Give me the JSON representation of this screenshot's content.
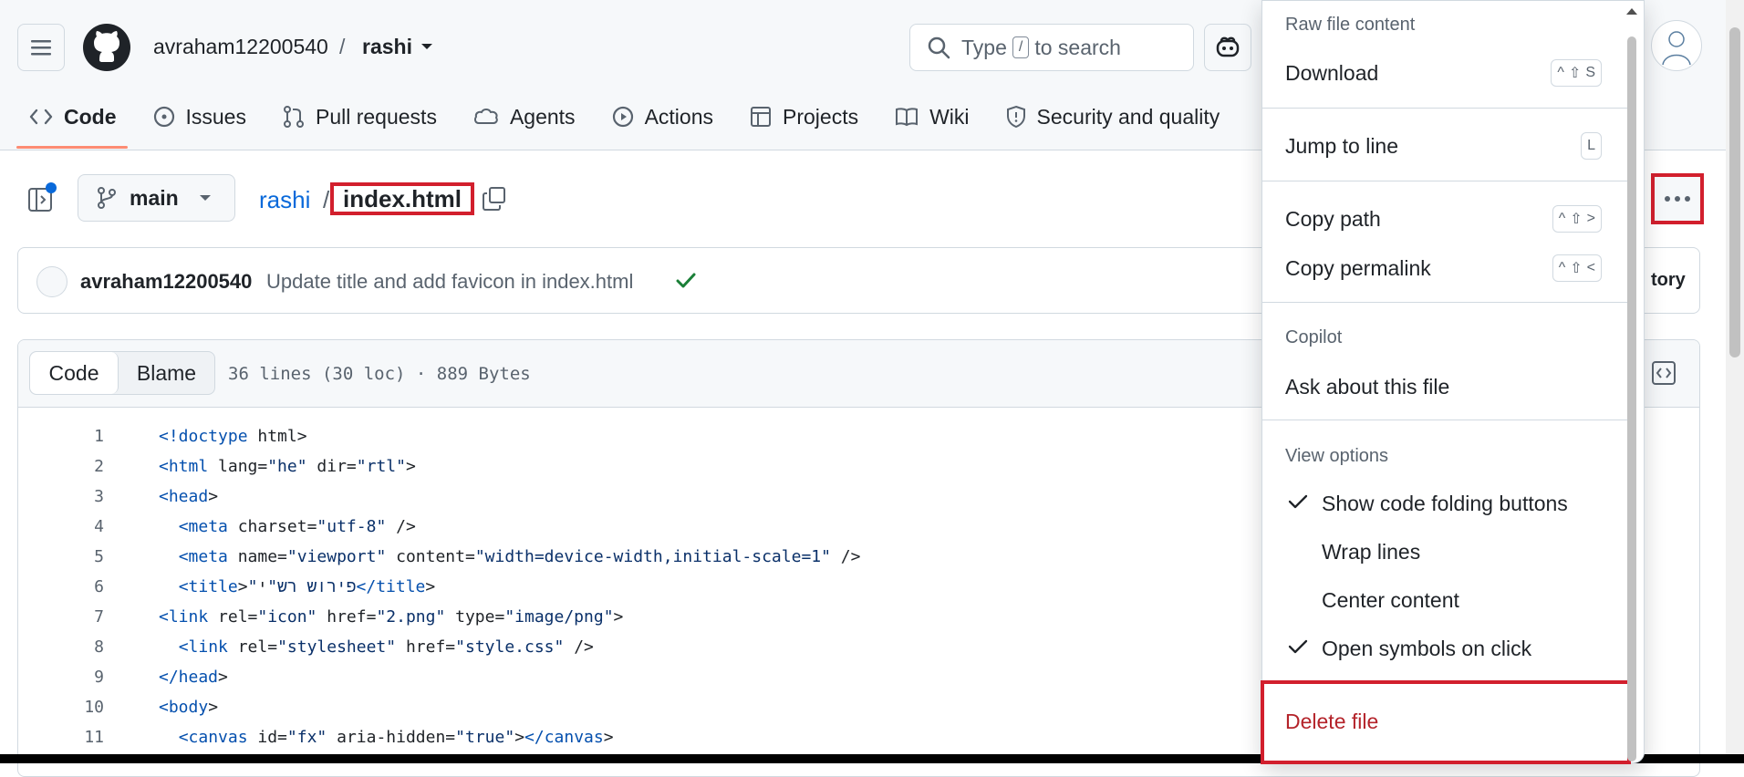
{
  "header": {
    "owner": "avraham12200540",
    "separator": "/",
    "repo": "rashi",
    "search_prefix": "Type",
    "search_key": "/",
    "search_suffix": "to search"
  },
  "tabs": [
    {
      "label": "Code"
    },
    {
      "label": "Issues"
    },
    {
      "label": "Pull requests"
    },
    {
      "label": "Agents"
    },
    {
      "label": "Actions"
    },
    {
      "label": "Projects"
    },
    {
      "label": "Wiki"
    },
    {
      "label": "Security and quality"
    }
  ],
  "file_nav": {
    "branch": "main",
    "repo_crumb": "rashi",
    "crumb_sep": "/",
    "file_name": "index.html"
  },
  "commit": {
    "author": "avraham12200540",
    "message": "Update title and add favicon in index.html",
    "history_partial": "tory"
  },
  "file": {
    "view_code": "Code",
    "view_blame": "Blame",
    "meta": "36 lines (30 loc) · 889 Bytes"
  },
  "code_lines": [
    {
      "n": "1",
      "text": "<!doctype html>"
    },
    {
      "n": "2",
      "text": "<html lang=\"he\" dir=\"rtl\">"
    },
    {
      "n": "3",
      "text": "<head>"
    },
    {
      "n": "4",
      "text": "  <meta charset=\"utf-8\" />"
    },
    {
      "n": "5",
      "text": "  <meta name=\"viewport\" content=\"width=device-width,initial-scale=1\" />"
    },
    {
      "n": "6",
      "text": "  <title>\"פירוש רש\"י</title>"
    },
    {
      "n": "7",
      "text": "<link rel=\"icon\" href=\"2.png\" type=\"image/png\">"
    },
    {
      "n": "8",
      "text": "  <link rel=\"stylesheet\" href=\"style.css\" />"
    },
    {
      "n": "9",
      "text": "</head>"
    },
    {
      "n": "10",
      "text": "<body>"
    },
    {
      "n": "11",
      "text": "  <canvas id=\"fx\" aria-hidden=\"true\"></canvas>"
    }
  ],
  "menu": {
    "raw_title": "Raw file content",
    "download": "Download",
    "download_keys": [
      "^",
      "⇧",
      "S"
    ],
    "jump": "Jump to line",
    "jump_key": "L",
    "copy_path": "Copy path",
    "copy_path_keys": [
      "^",
      "⇧",
      ">"
    ],
    "copy_permalink": "Copy permalink",
    "copy_permalink_keys": [
      "^",
      "⇧",
      "<"
    ],
    "copilot_title": "Copilot",
    "ask": "Ask about this file",
    "view_title": "View options",
    "show_folding": "Show code folding buttons",
    "wrap_lines": "Wrap lines",
    "center_content": "Center content",
    "open_symbols": "Open symbols on click",
    "delete": "Delete file"
  },
  "colors": {
    "accent_link": "#0969da",
    "danger": "#b4232a",
    "highlight_border": "#d21f2d",
    "success": "#1a7f37"
  }
}
